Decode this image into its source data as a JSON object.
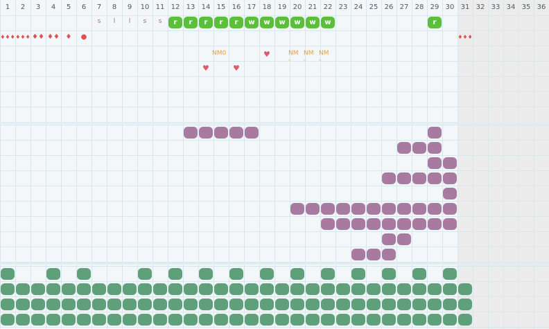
{
  "days": [
    "1",
    "2",
    "3",
    "4",
    "5",
    "6",
    "7",
    "8",
    "9",
    "10",
    "11",
    "12",
    "13",
    "14",
    "15",
    "16",
    "17",
    "18",
    "19",
    "20",
    "21",
    "22",
    "23",
    "24",
    "25",
    "26",
    "27",
    "28",
    "29",
    "30",
    "31",
    "32",
    "33",
    "34",
    "35",
    "36"
  ],
  "colors": {
    "grid": "#d7e7ed",
    "shade": "#ececec",
    "green_badge": "#5cbf3c",
    "purple": "#a87aa0",
    "green_blob": "#5fa07a",
    "drop": "#e0524f",
    "nm": "#f0a020",
    "heart": "#e05a6a"
  },
  "row1_letters": [
    {
      "day": 7,
      "text": "s"
    },
    {
      "day": 8,
      "text": "l"
    },
    {
      "day": 9,
      "text": "l"
    },
    {
      "day": 10,
      "text": "s"
    },
    {
      "day": 11,
      "text": "s"
    }
  ],
  "row1_badges": [
    {
      "day": 12,
      "text": "r"
    },
    {
      "day": 13,
      "text": "r"
    },
    {
      "day": 14,
      "text": "r"
    },
    {
      "day": 15,
      "text": "r"
    },
    {
      "day": 16,
      "text": "r"
    },
    {
      "day": 17,
      "text": "w"
    },
    {
      "day": 18,
      "text": "w"
    },
    {
      "day": 19,
      "text": "w"
    },
    {
      "day": 20,
      "text": "w"
    },
    {
      "day": 21,
      "text": "w"
    },
    {
      "day": 22,
      "text": "w"
    },
    {
      "day": 29,
      "text": "r"
    }
  ],
  "drops": [
    {
      "day": 1,
      "count": 3
    },
    {
      "day": 2,
      "count": 3
    },
    {
      "day": 3,
      "count": 2
    },
    {
      "day": 4,
      "count": 2
    },
    {
      "day": 5,
      "count": 1
    },
    {
      "day": 6,
      "count": 0
    },
    {
      "day": 31,
      "count": 3
    }
  ],
  "nm_labels": [
    {
      "day": 15,
      "text": "NM0"
    },
    {
      "day": 20,
      "text": "NM -"
    },
    {
      "day": 21,
      "text": "NM -"
    },
    {
      "day": 22,
      "text": "NM -"
    }
  ],
  "hearts": [
    {
      "day": 14,
      "row": 4
    },
    {
      "day": 16,
      "row": 4
    },
    {
      "day": 18,
      "row": 3
    }
  ],
  "purple_rows": [
    [
      13,
      14,
      15,
      16,
      17,
      29
    ],
    [
      27,
      28,
      29
    ],
    [
      29,
      30
    ],
    [
      26,
      27,
      28,
      29,
      30
    ],
    [
      30
    ],
    [
      20,
      21,
      22,
      23,
      24,
      25,
      26,
      27,
      28,
      29,
      30
    ],
    [
      22,
      23,
      24,
      25,
      26,
      27,
      28,
      29,
      30
    ],
    [
      26,
      27
    ],
    [
      24,
      25,
      26
    ]
  ],
  "green_rows": [
    [
      1,
      4,
      6,
      10,
      12,
      14,
      16,
      18,
      20,
      22,
      24,
      26,
      28,
      30
    ],
    [
      1,
      2,
      3,
      4,
      5,
      6,
      7,
      8,
      9,
      10,
      11,
      12,
      13,
      14,
      15,
      16,
      17,
      18,
      19,
      20,
      21,
      22,
      23,
      24,
      25,
      26,
      27,
      28,
      29,
      30,
      31
    ],
    [
      1,
      2,
      3,
      4,
      5,
      6,
      7,
      8,
      9,
      10,
      11,
      12,
      13,
      14,
      15,
      16,
      17,
      18,
      19,
      20,
      21,
      22,
      23,
      24,
      25,
      26,
      27,
      28,
      29,
      30,
      31
    ],
    [
      1,
      2,
      3,
      4,
      5,
      6,
      7,
      8,
      9,
      10,
      11,
      12,
      13,
      14,
      15,
      16,
      17,
      18,
      19,
      20,
      21,
      22,
      23,
      24,
      25,
      26,
      27,
      28,
      29,
      30,
      31
    ]
  ]
}
